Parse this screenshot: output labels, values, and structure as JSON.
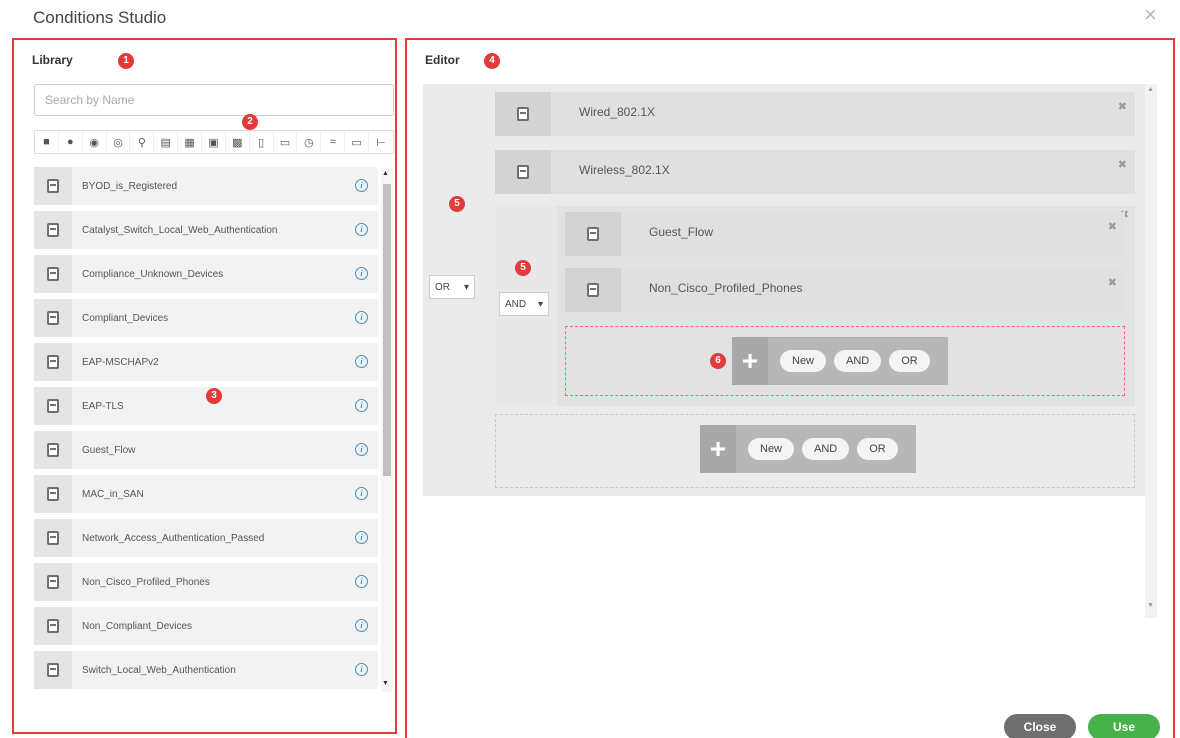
{
  "dialog": {
    "title": "Conditions Studio",
    "close_glyph": "×"
  },
  "library": {
    "heading": "Library",
    "search_placeholder": "Search by Name",
    "filter_icons": [
      "person-icon",
      "cloud-icon",
      "shield-icon",
      "globe-icon",
      "location-icon",
      "monitor-icon",
      "grid-icon",
      "network-icon",
      "desktop-icon",
      "device-icon",
      "document-icon",
      "clock-icon",
      "wifi-icon",
      "card-icon",
      "tree-icon",
      "device-small-icon"
    ],
    "items": [
      "BYOD_is_Registered",
      "Catalyst_Switch_Local_Web_Authentication",
      "Compliance_Unknown_Devices",
      "Compliant_Devices",
      "EAP-MSCHAPv2",
      "EAP-TLS",
      "Guest_Flow",
      "MAC_in_SAN",
      "Network_Access_Authentication_Passed",
      "Non_Cisco_Profiled_Phones",
      "Non_Compliant_Devices",
      "Switch_Local_Web_Authentication"
    ]
  },
  "editor": {
    "heading": "Editor",
    "outer_operator": "OR",
    "conditions": [
      "Wired_802.1X",
      "Wireless_802.1X"
    ],
    "inner_group": {
      "operator": "AND",
      "conditions": [
        "Guest_Flow",
        "Non_Cisco_Profiled_Phones"
      ]
    },
    "toolbar": {
      "new": "New",
      "and": "AND",
      "or": "OR"
    }
  },
  "callouts": {
    "c1": "1",
    "c2": "2",
    "c3": "3",
    "c4": "4",
    "c5": "5",
    "c6": "6"
  },
  "footer": {
    "close_label": "Close",
    "use_label": "Use"
  },
  "colors": {
    "callout": "#e33b3b",
    "use": "#47b14c",
    "close": "#6f6f6f",
    "info": "#3d8fd6"
  }
}
